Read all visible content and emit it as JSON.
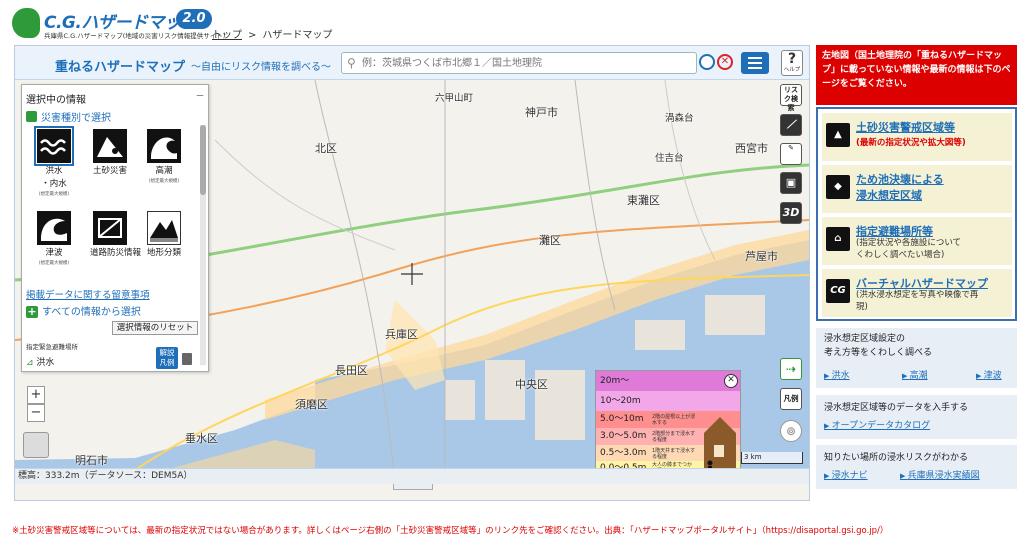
{
  "header": {
    "logo_title": "C.G.ハザードマップ",
    "logo_version": "2.0",
    "logo_subtitle": "兵庫県C.G.ハザードマップ(地域の災害リスク情報提供サイト)"
  },
  "breadcrumb": {
    "top": "トップ",
    "separator": ">",
    "current": "ハザードマップ"
  },
  "map": {
    "title": "重ねるハザードマップ",
    "subtitle": "〜自由にリスク情報を調べる〜",
    "search_placeholder": "例：茨城県つくば市北郷１／国土地理院",
    "help_label": "?",
    "help_sub": "ヘルプ",
    "risk_tool_label": "リスク検索",
    "legend_tool_label": "凡例",
    "tool_3d_label": "3D",
    "elevation_text": "標高：333.2m（データソース：DEM5A）",
    "scale_label": "3 km",
    "places": [
      {
        "name": "神戸市",
        "big": true
      },
      {
        "name": "六甲山町"
      },
      {
        "name": "渦森台"
      },
      {
        "name": "住吉台"
      },
      {
        "name": "北区"
      },
      {
        "name": "西宮市"
      },
      {
        "name": "東灘区"
      },
      {
        "name": "灘区"
      },
      {
        "name": "芦屋市"
      },
      {
        "name": "中央区"
      },
      {
        "name": "兵庫区"
      },
      {
        "name": "長田区"
      },
      {
        "name": "須磨区"
      },
      {
        "name": "明石市"
      },
      {
        "name": "垂水区"
      }
    ]
  },
  "left_panel": {
    "title": "選択中の情報",
    "collapse": "－",
    "category_label": "災害種別で選択",
    "hazards": [
      {
        "label": "洪水",
        "label2": "・内水",
        "note": "(想定最大規模)",
        "selected": true
      },
      {
        "label": "土砂災害",
        "label2": "",
        "note": "",
        "selected": false
      },
      {
        "label": "高潮",
        "label2": "",
        "note": "(想定最大規模)",
        "selected": false
      },
      {
        "label": "津波",
        "label2": "",
        "note": "(想定最大規模)",
        "selected": false
      },
      {
        "label": "道路防災情報",
        "label2": "",
        "note": "",
        "selected": false
      },
      {
        "label": "地形分類",
        "label2": "",
        "note": "",
        "selected": false
      }
    ],
    "caution_link": "掲載データに関する留意事項",
    "all_info_label": "すべての情報から選択",
    "reset_button": "選択情報のリセット",
    "shelter_label": "指定緊急避難場所",
    "layer_name": "洪水",
    "legend_button": "解説凡例"
  },
  "depth_legend": [
    {
      "range": "20m〜",
      "desc": "",
      "color": "#e07ad8"
    },
    {
      "range": "10〜20m",
      "desc": "",
      "color": "#f2a7e8"
    },
    {
      "range": "5.0〜10m",
      "desc": "2階の屋根以上が浸水する",
      "color": "#ff8f8f"
    },
    {
      "range": "3.0〜5.0m",
      "desc": "2階部分まで浸水する程度",
      "color": "#ffb0b0"
    },
    {
      "range": "0.5〜3.0m",
      "desc": "1階天井まで浸水する程度",
      "color": "#ffd9b3"
    },
    {
      "range": "0.0〜0.5m",
      "desc": "大人の膝までつかる程度",
      "color": "#fff4a6"
    }
  ],
  "sidebar": {
    "notice": "左地図（国土地理院の「重ねるハザードマップ」に載っていない情報や最新の情報は下のページをご覧ください。",
    "links": [
      {
        "title": "土砂災害警戒区域等",
        "title2": "",
        "desc": "(最新の指定状況や拡大図等)",
        "desc_red": true,
        "icon": "landslide-icon"
      },
      {
        "title": "ため池決壊による",
        "title2": "浸水想定区域",
        "desc": "",
        "desc_red": false,
        "icon": "reservoir-icon"
      },
      {
        "title": "指定避難場所等",
        "title2": "",
        "desc": "(指定状況や各施設について",
        "desc2": "くわしく調べたい場合)",
        "desc_red": false,
        "icon": "shelter-icon"
      },
      {
        "title": "バーチャルハザードマップ",
        "title2": "",
        "desc": "(洪水浸水想定を写真や映像で再",
        "desc2": "現)",
        "desc_red": false,
        "icon": "cg-icon"
      }
    ],
    "info1_line1": "浸水想定区域設定の",
    "info1_line2": "考え方等をくわしく調べる",
    "info1_links": [
      "洪水",
      "高潮",
      "津波"
    ],
    "info2_line1": "浸水想定区域等のデータを入手する",
    "info2_link": "オープンデータカタログ",
    "info3_line1": "知りたい場所の浸水リスクがわかる",
    "info3_links": [
      "浸水ナビ",
      "兵庫県浸水実績図"
    ]
  },
  "footnote": "※土砂災害警戒区域等については、最新の指定状況ではない場合があります。詳しくはページ右側の「土砂災害警戒区域等」のリンク先をご確認ください。出典：「ハザードマップポータルサイト」（https://disaportal.gsi.go.jp/）",
  "colors": {
    "accent": "#1f6fb8",
    "notice_red": "#dd0000",
    "sea": "#a9c7e6",
    "brand_green": "#2e9a3a"
  }
}
